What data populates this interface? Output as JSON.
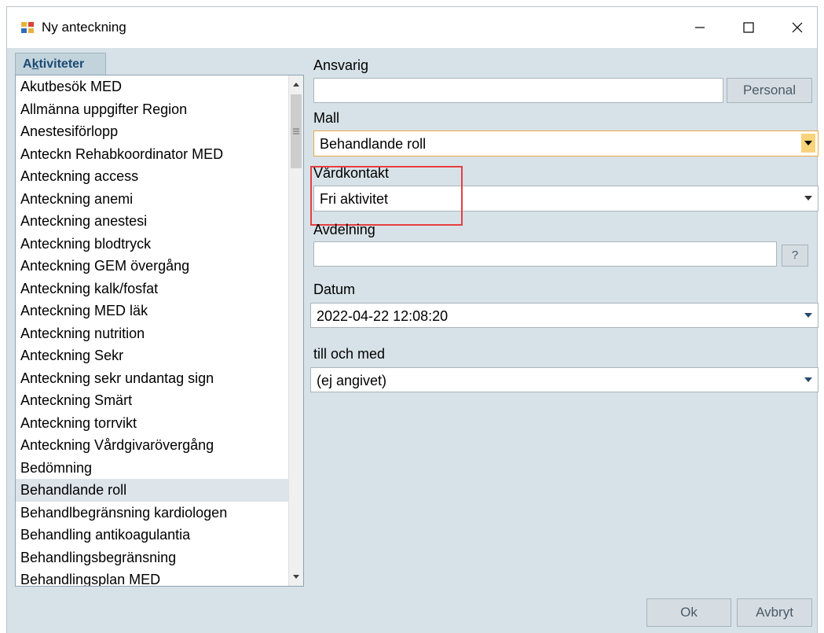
{
  "window": {
    "title": "Ny anteckning"
  },
  "tab": {
    "label_a": "A",
    "label_k": "k",
    "label_rest": "tiviteter"
  },
  "activities": [
    "Akutbesök MED",
    "Allmänna uppgifter Region",
    "Anestesiförlopp",
    "Anteckn Rehabkoordinator MED",
    "Anteckning access",
    "Anteckning anemi",
    "Anteckning anestesi",
    "Anteckning blodtryck",
    "Anteckning GEM övergång",
    "Anteckning kalk/fosfat",
    "Anteckning MED läk",
    "Anteckning nutrition",
    "Anteckning Sekr",
    "Anteckning sekr undantag sign",
    "Anteckning Smärt",
    "Anteckning torrvikt",
    "Anteckning Vårdgivarövergång",
    "Bedömning",
    "Behandlande roll",
    "Behandlbegränsning kardiologen",
    "Behandling antikoagulantia",
    "Behandlingsbegränsning",
    "Behandlingsplan MED"
  ],
  "selected_activity": "Behandlande roll",
  "form": {
    "ansvarig": {
      "label": "Ansvarig",
      "value": "",
      "button": "Personal"
    },
    "mall": {
      "label": "Mall",
      "value": "Behandlande roll"
    },
    "vardkontakt": {
      "label": "Vårdkontakt",
      "value": "Fri aktivitet"
    },
    "avdelning": {
      "label": "Avdelning",
      "value": "",
      "button": "?"
    },
    "datum": {
      "label": "Datum",
      "value": "2022-04-22 12:08:20"
    },
    "till_och_med": {
      "label": "till och med",
      "value": "(ej angivet)"
    }
  },
  "buttons": {
    "ok": "Ok",
    "cancel": "Avbryt"
  },
  "colors": {
    "background": "#d7e2e8",
    "highlight": "#e53f3f",
    "tab_text": "#1c4a73"
  }
}
